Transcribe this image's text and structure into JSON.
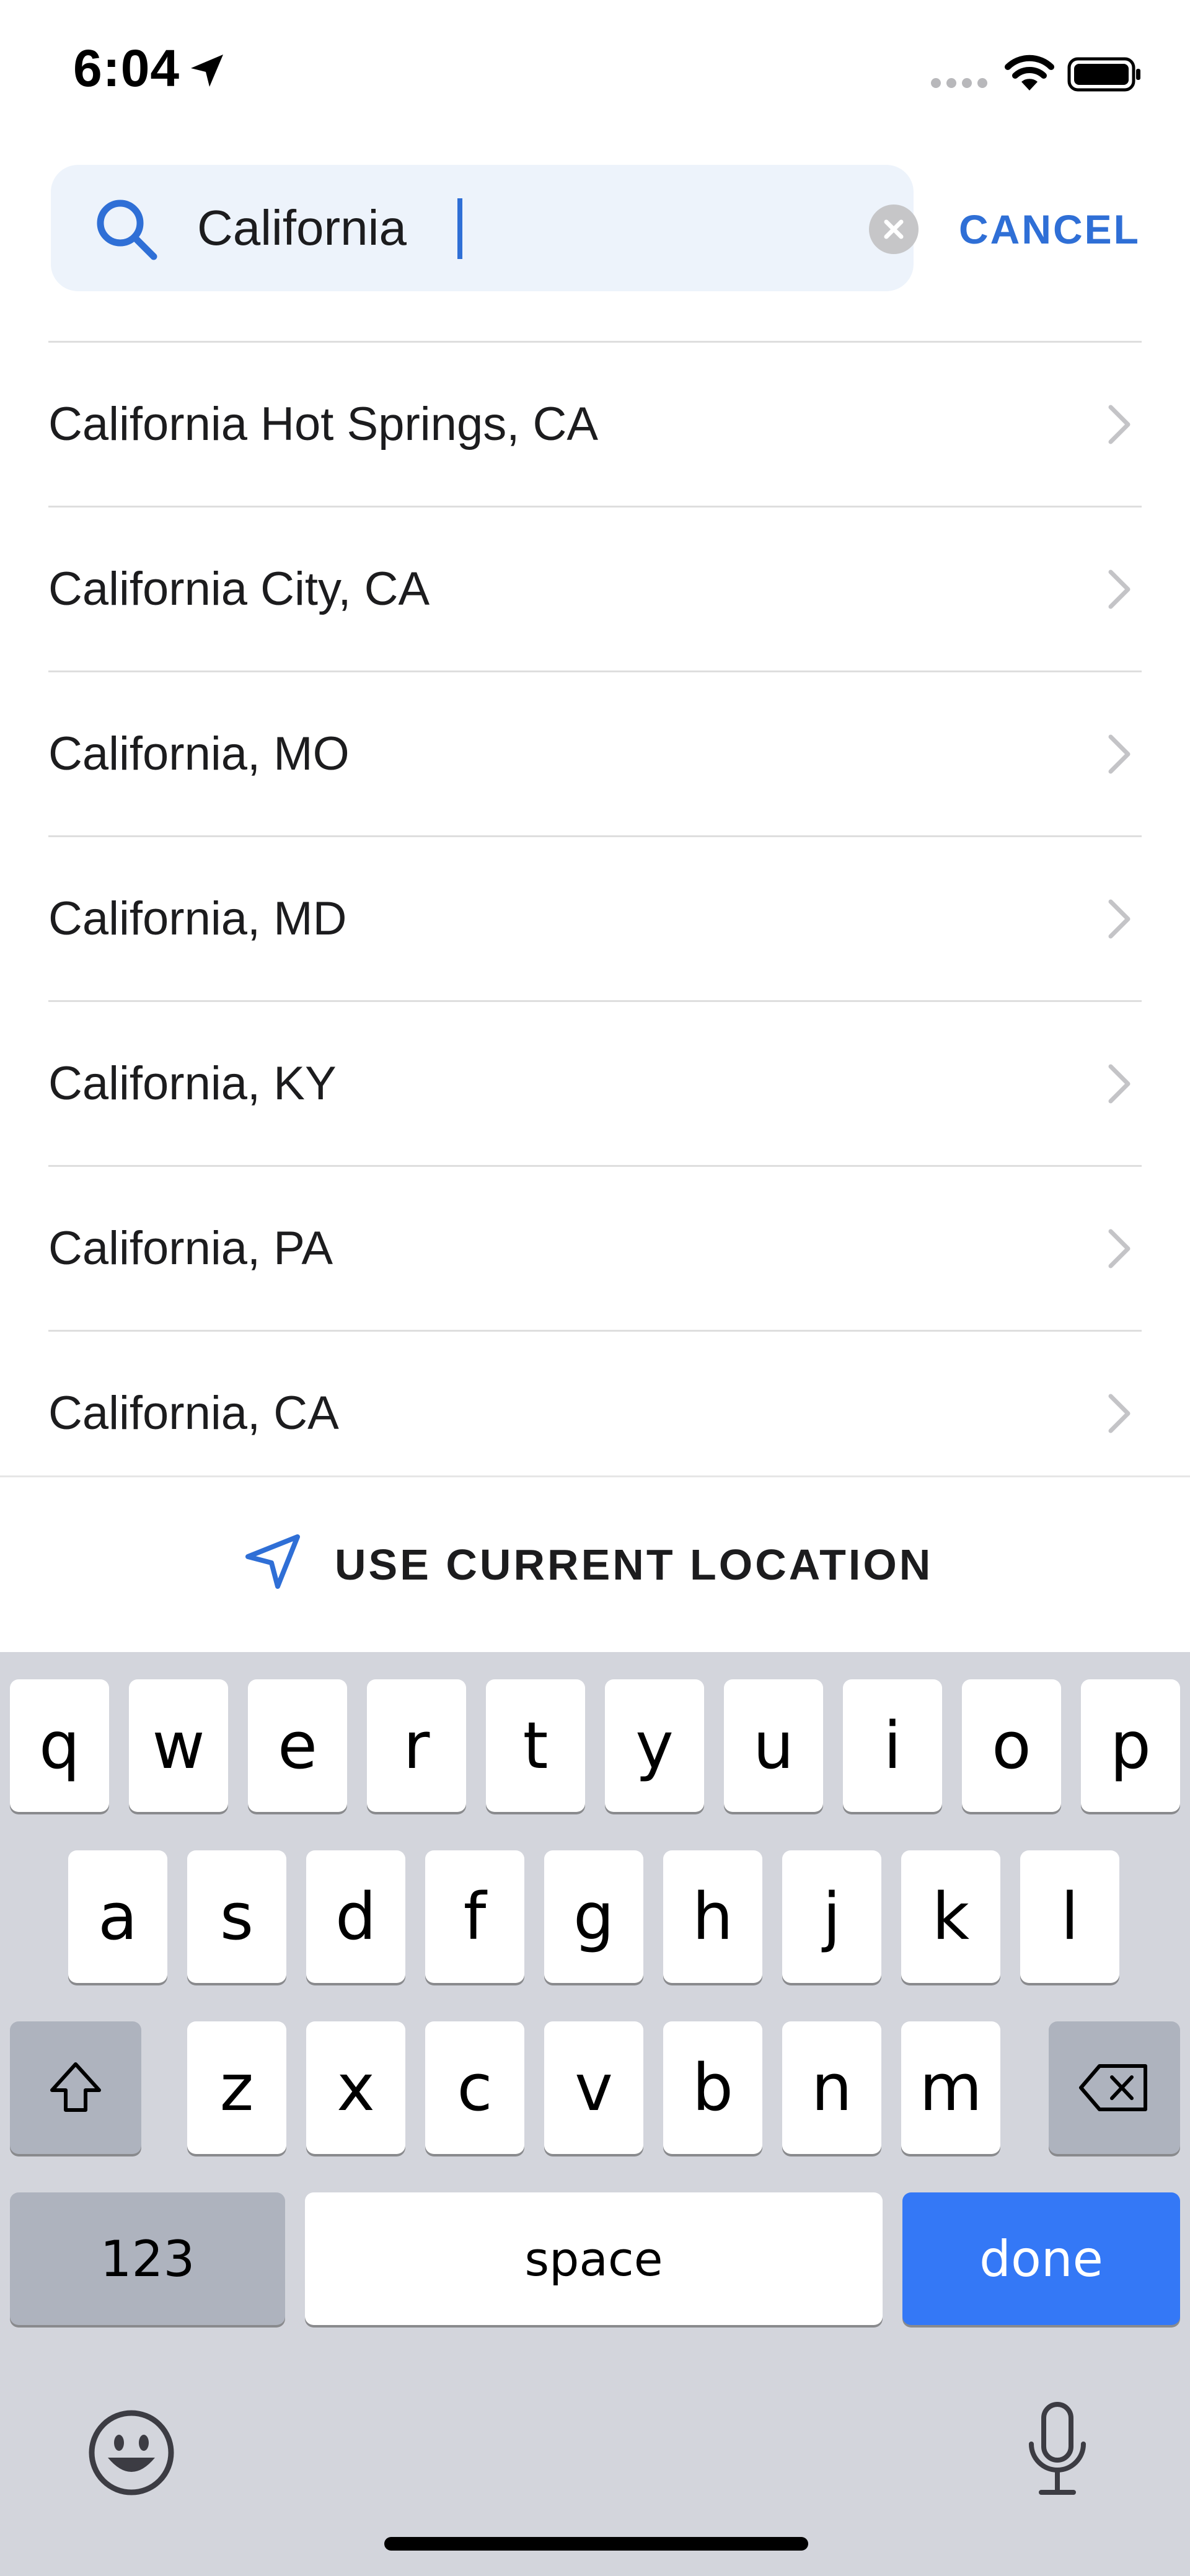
{
  "status_bar": {
    "time": "6:04"
  },
  "search": {
    "query": "California",
    "cancel_label": "CANCEL"
  },
  "results": [
    {
      "label": "California Hot Springs, CA"
    },
    {
      "label": "California City, CA"
    },
    {
      "label": "California, MO"
    },
    {
      "label": "California, MD"
    },
    {
      "label": "California, KY"
    },
    {
      "label": "California, PA"
    },
    {
      "label": "California, CA"
    }
  ],
  "location": {
    "label": "USE CURRENT LOCATION"
  },
  "keyboard": {
    "row1": [
      "q",
      "w",
      "e",
      "r",
      "t",
      "y",
      "u",
      "i",
      "o",
      "p"
    ],
    "row2": [
      "a",
      "s",
      "d",
      "f",
      "g",
      "h",
      "j",
      "k",
      "l"
    ],
    "row3": [
      "z",
      "x",
      "c",
      "v",
      "b",
      "n",
      "m"
    ],
    "numbers_label": "123",
    "space_label": "space",
    "done_label": "done"
  },
  "colors": {
    "accent": "#2f6fd6",
    "done_key": "#3478f6",
    "search_bg": "#edf3fb",
    "keyboard_bg": "#d3d5dc"
  },
  "icons": [
    "search-icon",
    "clear-icon",
    "chevron-right-icon",
    "navigation-arrow-icon",
    "shift-icon",
    "backspace-icon",
    "emoji-icon",
    "microphone-icon",
    "signal-icon",
    "wifi-icon",
    "battery-icon",
    "location-arrow-icon"
  ]
}
